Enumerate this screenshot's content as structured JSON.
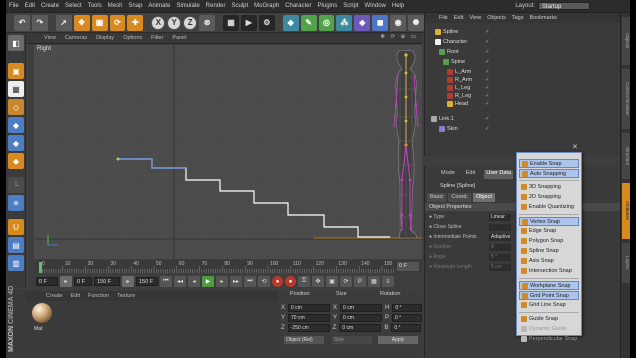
{
  "menubar": {
    "items": [
      "File",
      "Edit",
      "Create",
      "Select",
      "Tools",
      "Mesh",
      "Snap",
      "Animate",
      "Simulate",
      "Render",
      "Sculpt",
      "MoGraph",
      "Character",
      "Plugins",
      "Script",
      "Window",
      "Help"
    ],
    "layout_label": "Layout:",
    "layout_value": "Startup"
  },
  "toolbar": {
    "axis_x": "X",
    "axis_y": "Y",
    "axis_z": "Z"
  },
  "viewport": {
    "menu": [
      "View",
      "Cameras",
      "Display",
      "Options",
      "Filter",
      "Panel"
    ],
    "label": "Right",
    "controls": "✥ ⟳ ⊕ ▭"
  },
  "timeline": {
    "ticks": [
      "0",
      "10",
      "20",
      "30",
      "40",
      "50",
      "60",
      "70",
      "80",
      "90",
      "100",
      "110",
      "120",
      "130",
      "140",
      "150"
    ],
    "current_frame": "0 F"
  },
  "transport": {
    "start_field": "0 F",
    "min_field": "0 F",
    "end_field": "150 F",
    "max_field": "150 F"
  },
  "material_manager": {
    "menu": [
      "Create",
      "Edit",
      "Function",
      "Texture"
    ],
    "material_name": "Mat"
  },
  "brand": {
    "maxon": "MAXON",
    "product": "CINEMA 4D"
  },
  "coordinates": {
    "headers": [
      "Position",
      "Size",
      "Rotation"
    ],
    "rows": [
      {
        "axis": "X",
        "pos": "0 cm",
        "size_axis": "X",
        "size": "0 cm",
        "rot_axis": "H",
        "rot": "0 °"
      },
      {
        "axis": "Y",
        "pos": "70 cm",
        "size_axis": "Y",
        "size": "0 cm",
        "rot_axis": "P",
        "rot": "0 °"
      },
      {
        "axis": "Z",
        "pos": "-250 cm",
        "size_axis": "Z",
        "size": "0 cm",
        "rot_axis": "B",
        "rot": "0 °"
      }
    ],
    "mode": "Object (Rel)",
    "size_mode": "Size",
    "apply": "Apply"
  },
  "object_manager": {
    "menu": [
      "File",
      "Edit",
      "View",
      "Objects",
      "Tags",
      "Bookmarks"
    ],
    "objects": [
      {
        "name": "Spline",
        "color": "#e0b030"
      },
      {
        "name": "Character",
        "color": "#f0f0f0"
      },
      {
        "name": "Root",
        "color": "#5a9e4a"
      },
      {
        "name": "Spine",
        "color": "#5a9e4a"
      },
      {
        "name": "L_Arm",
        "color": "#b43a30"
      },
      {
        "name": "R_Arm",
        "color": "#b43a30"
      },
      {
        "name": "L_Leg",
        "color": "#b43a30"
      },
      {
        "name": "R_Leg",
        "color": "#b43a30"
      },
      {
        "name": "Head",
        "color": "#d8b430"
      },
      {
        "name": "Link.1",
        "color": "#aaaaaa"
      },
      {
        "name": "Skin",
        "color": "#8a7cc8"
      }
    ],
    "visible_flags": "✓"
  },
  "attribute_manager": {
    "modes": [
      "Mode",
      "Edit",
      "User Data"
    ],
    "title": "Spline [Spline]",
    "tabs": [
      "Basic",
      "Coord.",
      "Object"
    ],
    "section": "Object Properties",
    "props": [
      {
        "label": "● Type",
        "value": "Linear"
      },
      {
        "label": "● Close Spline",
        "value": ""
      },
      {
        "label": "● Intermediate Points",
        "value": "Adaptive"
      },
      {
        "label": "● Number",
        "value": "8"
      },
      {
        "label": "● Angle",
        "value": "5 °"
      },
      {
        "label": "● Maximum Length",
        "value": "5 cm"
      }
    ]
  },
  "snap_menu": {
    "items": [
      {
        "label": "Enable Snap",
        "state": "checked"
      },
      {
        "label": "Auto Snapping",
        "state": "checked"
      },
      {
        "label": "3D Snapping",
        "state": "normal"
      },
      {
        "label": "2D Snapping",
        "state": "normal"
      },
      {
        "label": "Enable Quantizing",
        "state": "normal"
      },
      {
        "label": "Vertex Snap",
        "state": "checked"
      },
      {
        "label": "Edge Snap",
        "state": "normal"
      },
      {
        "label": "Polygon Snap",
        "state": "normal"
      },
      {
        "label": "Spline Snap",
        "state": "normal"
      },
      {
        "label": "Axis Snap",
        "state": "normal"
      },
      {
        "label": "Intersection Snap",
        "state": "normal"
      },
      {
        "label": "Workplane Snap",
        "state": "checked"
      },
      {
        "label": "Grid Point Snap",
        "state": "checked"
      },
      {
        "label": "Grid Line Snap",
        "state": "normal"
      },
      {
        "label": "Guide Snap",
        "state": "normal"
      },
      {
        "label": "Dynamic Guide",
        "state": "dim"
      },
      {
        "label": "Perpendicular Snap",
        "state": "dim"
      }
    ]
  },
  "right_strip": {
    "tabs": [
      "Objects",
      "Content Browser",
      "Structure",
      "Attributes",
      "Layers"
    ]
  },
  "colors": {
    "accent": "#d88a1e",
    "selected_menu": "#abc5ec",
    "spline_white": "#ffffff",
    "spline_blue": "#6a8cd8",
    "skeleton_purple": "#c040c0",
    "skeleton_yellow": "#e0c020"
  }
}
